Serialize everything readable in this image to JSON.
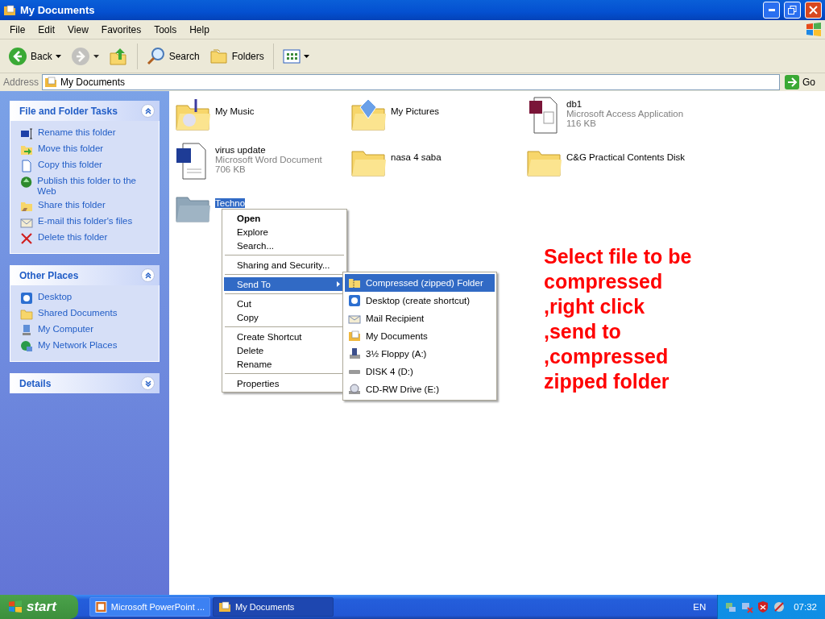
{
  "window": {
    "title": "My Documents"
  },
  "menu_bar": [
    "File",
    "Edit",
    "View",
    "Favorites",
    "Tools",
    "Help"
  ],
  "toolbar": [
    {
      "kind": "back",
      "label": "Back",
      "disabled": false
    },
    {
      "kind": "forward",
      "disabled": true
    },
    {
      "kind": "up",
      "disabled": false
    },
    {
      "kind": "search",
      "label": "Search",
      "disabled": false
    },
    {
      "kind": "folders",
      "label": "Folders",
      "disabled": false
    },
    {
      "kind": "views",
      "disabled": false
    }
  ],
  "address": {
    "label": "Address",
    "value": "My Documents",
    "go": "Go"
  },
  "panels": [
    {
      "title": "File and Folder Tasks",
      "expanded": true,
      "items": [
        {
          "kind": "rename",
          "label": "Rename this folder"
        },
        {
          "kind": "move",
          "label": "Move this folder"
        },
        {
          "kind": "copy",
          "label": "Copy this folder"
        },
        {
          "kind": "publish",
          "label": "Publish this folder to the Web"
        },
        {
          "kind": "share",
          "label": "Share this folder"
        },
        {
          "kind": "email",
          "label": "E-mail this folder's files"
        },
        {
          "kind": "delete",
          "label": "Delete this folder"
        }
      ]
    },
    {
      "title": "Other Places",
      "expanded": true,
      "items": [
        {
          "kind": "desktop",
          "label": "Desktop"
        },
        {
          "kind": "folder",
          "label": "Shared Documents"
        },
        {
          "kind": "computer",
          "label": "My Computer"
        },
        {
          "kind": "network",
          "label": "My Network Places"
        }
      ]
    },
    {
      "title": "Details",
      "expanded": false
    }
  ],
  "files": [
    {
      "kind": "music-folder",
      "name": "My Music",
      "selected": false
    },
    {
      "kind": "picture-folder",
      "name": "My Pictures",
      "selected": false
    },
    {
      "kind": "access",
      "name": "db1",
      "type": "Microsoft Access Application",
      "size": "116 KB",
      "selected": false
    },
    {
      "kind": "word",
      "name": "virus update",
      "type": "Microsoft Word Document",
      "size": "706 KB",
      "selected": false
    },
    {
      "kind": "folder",
      "name": "nasa 4 saba",
      "selected": false
    },
    {
      "kind": "folder",
      "name": "C&G Practical Contents Disk",
      "selected": false
    },
    {
      "kind": "folder",
      "name": "Techno",
      "selected": true
    }
  ],
  "context_menu": [
    [
      {
        "label": "Open",
        "default": true,
        "selected": false
      },
      {
        "label": "Explore",
        "default": false,
        "selected": false
      },
      {
        "label": "Search...",
        "default": false,
        "selected": false
      }
    ],
    [
      {
        "label": "Sharing and Security...",
        "default": false,
        "selected": false
      }
    ],
    [
      {
        "label": "Send To",
        "default": false,
        "selected": true,
        "submenu": true
      }
    ],
    [
      {
        "label": "Cut",
        "default": false,
        "selected": false
      },
      {
        "label": "Copy",
        "default": false,
        "selected": false
      }
    ],
    [
      {
        "label": "Create Shortcut",
        "default": false,
        "selected": false
      },
      {
        "label": "Delete",
        "default": false,
        "selected": false
      },
      {
        "label": "Rename",
        "default": false,
        "selected": false
      }
    ],
    [
      {
        "label": "Properties",
        "default": false,
        "selected": false
      }
    ]
  ],
  "send_to_menu": [
    {
      "kind": "zip",
      "label": "Compressed (zipped) Folder",
      "selected": true
    },
    {
      "kind": "desktop",
      "label": "Desktop (create shortcut)",
      "selected": false
    },
    {
      "kind": "mail",
      "label": "Mail Recipient",
      "selected": false
    },
    {
      "kind": "documents",
      "label": "My Documents",
      "selected": false
    },
    {
      "kind": "floppy",
      "label": "3½ Floppy (A:)",
      "selected": false
    },
    {
      "kind": "disk",
      "label": "DISK 4 (D:)",
      "selected": false
    },
    {
      "kind": "cd",
      "label": "CD-RW Drive (E:)",
      "selected": false
    }
  ],
  "annotation": "Select file to be\ncompressed\n,right click\n,send to\n,compressed\nzipped folder",
  "taskbar": {
    "start": "start",
    "tasks": [
      {
        "kind": "powerpoint",
        "label": "Microsoft PowerPoint ...",
        "selected": false
      },
      {
        "kind": "folder",
        "label": "My Documents",
        "selected": true
      }
    ],
    "language": "EN",
    "clock": "07:32"
  }
}
